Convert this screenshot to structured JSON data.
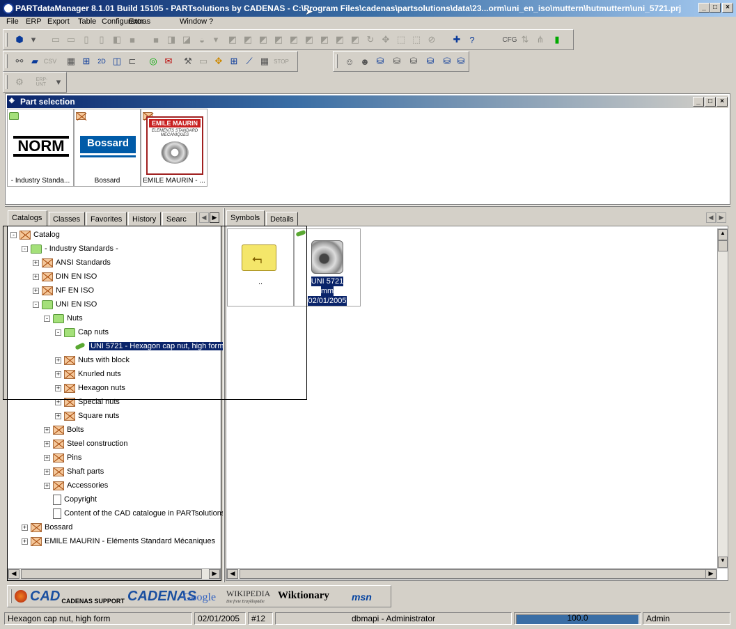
{
  "window": {
    "title": "PARTdataManager 8.1.01 Build 15105 - PARTsolutions by CADENAS - C:\\Program Files\\cadenas\\partsolutions\\data\\23...orm\\uni_en_iso\\muttern\\hutmuttern\\uni_5721.prj",
    "minimize": "_",
    "maximize": "□",
    "close": "×"
  },
  "menu": [
    "File",
    "ERP",
    "Export",
    "Table",
    "Configurator",
    "Extras",
    "Window",
    "?"
  ],
  "toolbar3": {
    "erp_label": "ERP-\nUNT"
  },
  "part_selection": {
    "title": "Part selection",
    "thumbnails": [
      {
        "logo": "NORM",
        "label": "- Industry Standa..."
      },
      {
        "logo": "Bossard",
        "label": "Bossard"
      },
      {
        "logo": "EMILE MAURIN",
        "logo_sub": "ELEMENTS STANDARD MECANIQUES",
        "label": "EMILE MAURIN - ..."
      }
    ]
  },
  "left_tabs": [
    "Catalogs",
    "Classes",
    "Favorites",
    "History",
    "Searc"
  ],
  "tree": [
    {
      "label": "Catalog",
      "icon": "cross",
      "toggle": "-"
    },
    {
      "label": "- Industry Standards -",
      "icon": "green",
      "toggle": "-"
    },
    {
      "label": "ANSI Standards",
      "icon": "cross",
      "toggle": "+"
    },
    {
      "label": "DIN EN ISO",
      "icon": "cross",
      "toggle": "+"
    },
    {
      "label": "NF EN ISO",
      "icon": "cross",
      "toggle": "+"
    },
    {
      "label": "UNI EN ISO",
      "icon": "green",
      "toggle": "-"
    },
    {
      "label": "Nuts",
      "icon": "green",
      "toggle": "-"
    },
    {
      "label": "Cap nuts",
      "icon": "green",
      "toggle": "-"
    },
    {
      "label": "UNI 5721  -  Hexagon cap nut, high form",
      "icon": "part",
      "toggle": ""
    },
    {
      "label": "Nuts with block",
      "icon": "cross",
      "toggle": "+"
    },
    {
      "label": "Knurled nuts",
      "icon": "cross",
      "toggle": "+"
    },
    {
      "label": "Hexagon nuts",
      "icon": "cross",
      "toggle": "+"
    },
    {
      "label": "Special nuts",
      "icon": "cross",
      "toggle": "+"
    },
    {
      "label": "Square nuts",
      "icon": "cross",
      "toggle": "+"
    },
    {
      "label": "Bolts",
      "icon": "cross",
      "toggle": "+"
    },
    {
      "label": "Steel construction",
      "icon": "cross",
      "toggle": "+"
    },
    {
      "label": "Pins",
      "icon": "cross",
      "toggle": "+"
    },
    {
      "label": "Shaft parts",
      "icon": "cross",
      "toggle": "+"
    },
    {
      "label": "Accessories",
      "icon": "cross",
      "toggle": "+"
    },
    {
      "label": "Copyright",
      "icon": "doc",
      "toggle": ""
    },
    {
      "label": "Content of the CAD catalogue in PARTsolutions",
      "icon": "doc",
      "toggle": ""
    },
    {
      "label": "Bossard",
      "icon": "cross",
      "toggle": "+"
    },
    {
      "label": "EMILE MAURIN - Eléments Standard Mécaniques",
      "icon": "cross",
      "toggle": "+"
    }
  ],
  "right_tabs": [
    "Symbols",
    "Details"
  ],
  "symbols": [
    {
      "label": "..",
      "kind": "folder-up"
    },
    {
      "label_lines": [
        "UNI 5721",
        "mm",
        "02/01/2005"
      ],
      "kind": "part"
    }
  ],
  "bottom_bar": {
    "links": [
      "CADENAS SUPPORT",
      "CADENAS",
      "Google",
      "WIKIPEDIA",
      "Die freie Enzyklopädie",
      "Wiktionary",
      "msn"
    ]
  },
  "status": {
    "description": "Hexagon cap nut, high form",
    "date": "02/01/2005",
    "number": "#12",
    "user": "dbmapi - Administrator",
    "progress_text": "100.0",
    "progress": 1.0,
    "role": "Admin"
  },
  "colors": {
    "title_dark": "#0a246a",
    "selection": "#0a246a",
    "progress": "#3a6ea5"
  }
}
